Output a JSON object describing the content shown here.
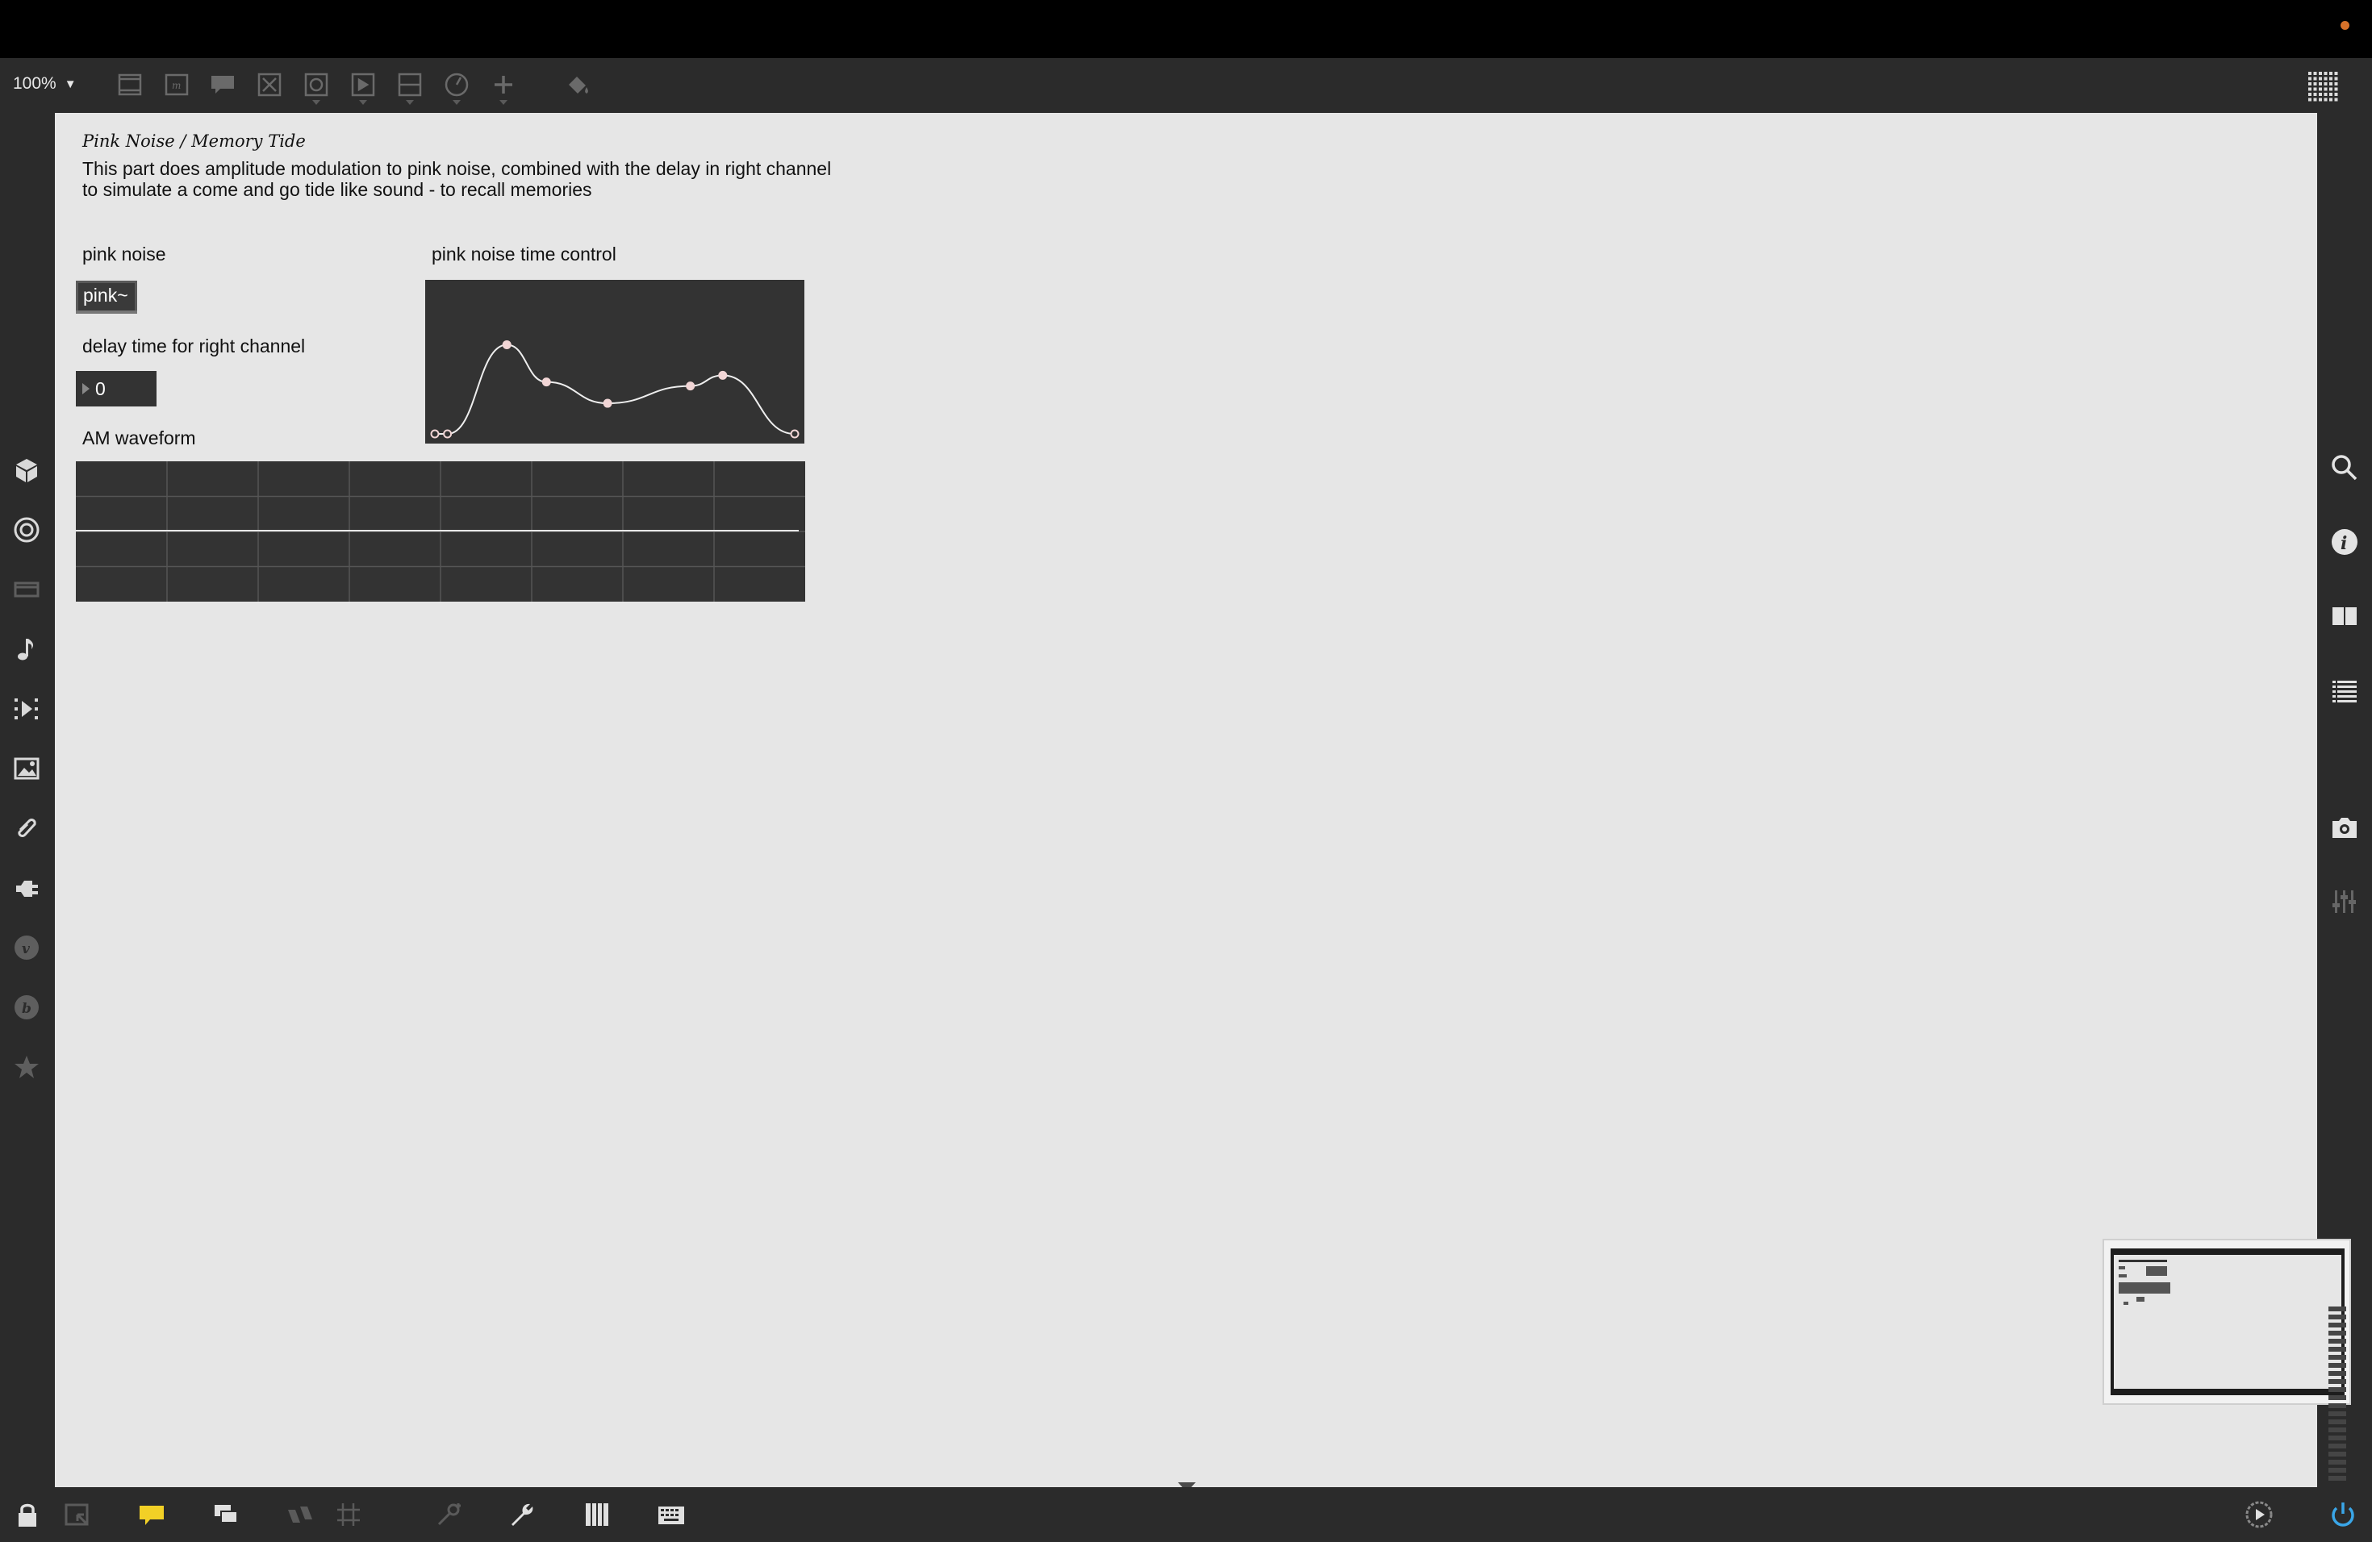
{
  "toolbar": {
    "zoom_label": "100%",
    "icons": [
      "new-object-icon",
      "message-icon",
      "comment-icon",
      "button-icon",
      "toggle-icon",
      "playbar-icon",
      "slider-icon",
      "dial-icon",
      "add-icon",
      "paint-bucket-icon"
    ]
  },
  "patcher": {
    "title": "Pink Noise / Memory Tide",
    "description": "This part does amplitude modulation to pink noise, combined with the delay in right channel to simulate a come and go tide like sound - to recall memories",
    "pink_noise_label": "pink noise",
    "pink_object_label": "pink~",
    "delay_label": "delay time for right channel",
    "delay_value": "0",
    "time_control_label": "pink noise time control",
    "am_waveform_label": "AM waveform"
  },
  "function_object": {
    "points": [
      [
        0.0,
        0.0
      ],
      [
        0.035,
        0.0
      ],
      [
        0.2,
        0.67
      ],
      [
        0.31,
        0.39
      ],
      [
        0.48,
        0.23
      ],
      [
        0.71,
        0.36
      ],
      [
        0.8,
        0.44
      ],
      [
        1.0,
        0.0
      ]
    ]
  },
  "scope_object": {
    "columns": 8,
    "rows": 4,
    "signal_level": 0.0
  },
  "left_sidebar": [
    "package-icon",
    "target-icon",
    "device-icon",
    "music-note-icon",
    "media-sequence-icon",
    "image-icon",
    "paperclip-icon",
    "plugin-icon",
    "vimeo-icon",
    "bpatcher-icon",
    "star-icon"
  ],
  "right_sidebar": [
    "search-icon",
    "info-icon",
    "book-icon",
    "list-icon",
    "camera-icon",
    "mixer-icon"
  ],
  "bottom_bar": [
    "lock-icon",
    "presentation-icon",
    "comment-bubble-icon",
    "windows-icon",
    "hide-icon",
    "grid-icon",
    "debug-icon",
    "wrench-icon",
    "piano-icon",
    "keyboard-icon",
    "transport-icon",
    "power-icon"
  ],
  "colors": {
    "canvas": "#e6e6e6",
    "chrome": "#2b2b2b",
    "object_fill": "#333333",
    "accent_power": "#3aa6e8",
    "title_dot": "#d8722a"
  }
}
